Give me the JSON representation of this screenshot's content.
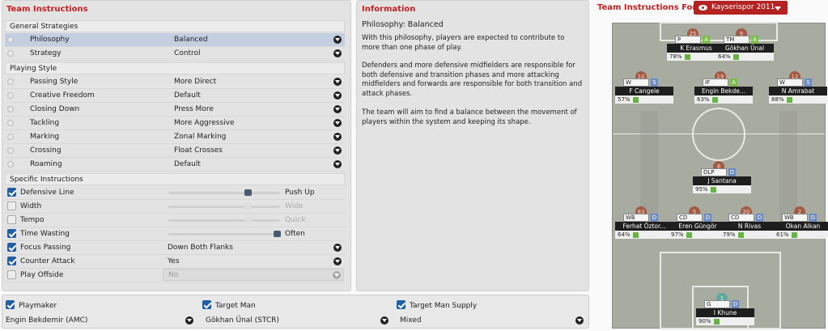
{
  "instructions": {
    "title": "Team Instructions",
    "general_header": "General Strategies",
    "general": [
      {
        "label": "Philosophy",
        "value": "Balanced"
      },
      {
        "label": "Strategy",
        "value": "Control"
      }
    ],
    "playing_header": "Playing Style",
    "playing": [
      {
        "label": "Passing Style",
        "value": "More Direct"
      },
      {
        "label": "Creative Freedom",
        "value": "Default"
      },
      {
        "label": "Closing Down",
        "value": "Press More"
      },
      {
        "label": "Tackling",
        "value": "More Aggressive"
      },
      {
        "label": "Marking",
        "value": "Zonal Marking"
      },
      {
        "label": "Crossing",
        "value": "Float Crosses"
      },
      {
        "label": "Roaming",
        "value": "Default"
      }
    ],
    "specific_header": "Specific Instructions",
    "specific": [
      {
        "label": "Defensive Line",
        "value": "Push Up",
        "checked": true,
        "level": 0.7
      },
      {
        "label": "Width",
        "value": "Wide",
        "checked": false,
        "level": 0.7
      },
      {
        "label": "Tempo",
        "value": "Quick",
        "checked": false,
        "level": 0.7
      },
      {
        "label": "Time Wasting",
        "value": "Often",
        "checked": true,
        "level": 1.0
      },
      {
        "label": "Focus Passing",
        "value": "Down Both Flanks",
        "checked": true
      },
      {
        "label": "Counter Attack",
        "value": "Yes",
        "checked": true
      },
      {
        "label": "Play Offside",
        "value": "No",
        "checked": false
      }
    ]
  },
  "information": {
    "title": "Information",
    "subtitle": "Philosophy: Balanced",
    "p1": "With this philosophy, players are expected to contribute to more than one phase of play.",
    "p2": "Defenders and more defensive midfielders are responsible for both defensive and transition phases and more attacking midfielders and forwards are responsible for both transition and attack phases.",
    "p3": "The team will aim to find a balance between the movement of players within the system and keeping its shape."
  },
  "team_for": {
    "label": "Team Instructions For:",
    "team": "Kayserispor 2011"
  },
  "players": [
    {
      "num": "25",
      "pos": "P",
      "duty": "A",
      "name": "K Erasmus",
      "pct": "78%"
    },
    {
      "num": "9",
      "pos": "TM",
      "duty": "A",
      "name": "Gökhan Ünal",
      "pct": "64%"
    },
    {
      "num": "10",
      "pos": "W",
      "duty": "S",
      "name": "F Cangele",
      "pct": "57%"
    },
    {
      "num": "19",
      "pos": "IF",
      "duty": "A",
      "name": "Engin Bekde...",
      "pct": "63%"
    },
    {
      "num": "11",
      "pos": "W",
      "duty": "S",
      "name": "N Amrabat",
      "pct": "88%"
    },
    {
      "num": "8",
      "pos": "DLP",
      "duty": "D",
      "name": "J Santana",
      "pct": "95%"
    },
    {
      "num": "83",
      "pos": "WB",
      "duty": "D",
      "name": "Ferhat Öztor...",
      "pct": "64%"
    },
    {
      "num": "5",
      "pos": "CD",
      "duty": "D",
      "name": "Eren Güngör",
      "pct": "97%"
    },
    {
      "num": "20",
      "pos": "CD",
      "duty": "D",
      "name": "N Rivas",
      "pct": "79%"
    },
    {
      "num": "2",
      "pos": "WB",
      "duty": "D",
      "name": "Okan Alkan",
      "pct": "61%"
    },
    {
      "num": "1",
      "pos": "G",
      "duty": "D",
      "name": "I Khune",
      "pct": "90%",
      "gk": true
    }
  ],
  "bottom": [
    {
      "label": "Playmaker",
      "value": "Engin Bekdemir (AMC)"
    },
    {
      "label": "Target Man",
      "value": "Gökhan Ünal (STCR)"
    },
    {
      "label": "Target Man Supply",
      "value": "Mixed"
    }
  ],
  "colors": {
    "accent": "#c81e1e",
    "selected_row": "#c3cfe1",
    "checkbox": "#1e5fa8"
  }
}
